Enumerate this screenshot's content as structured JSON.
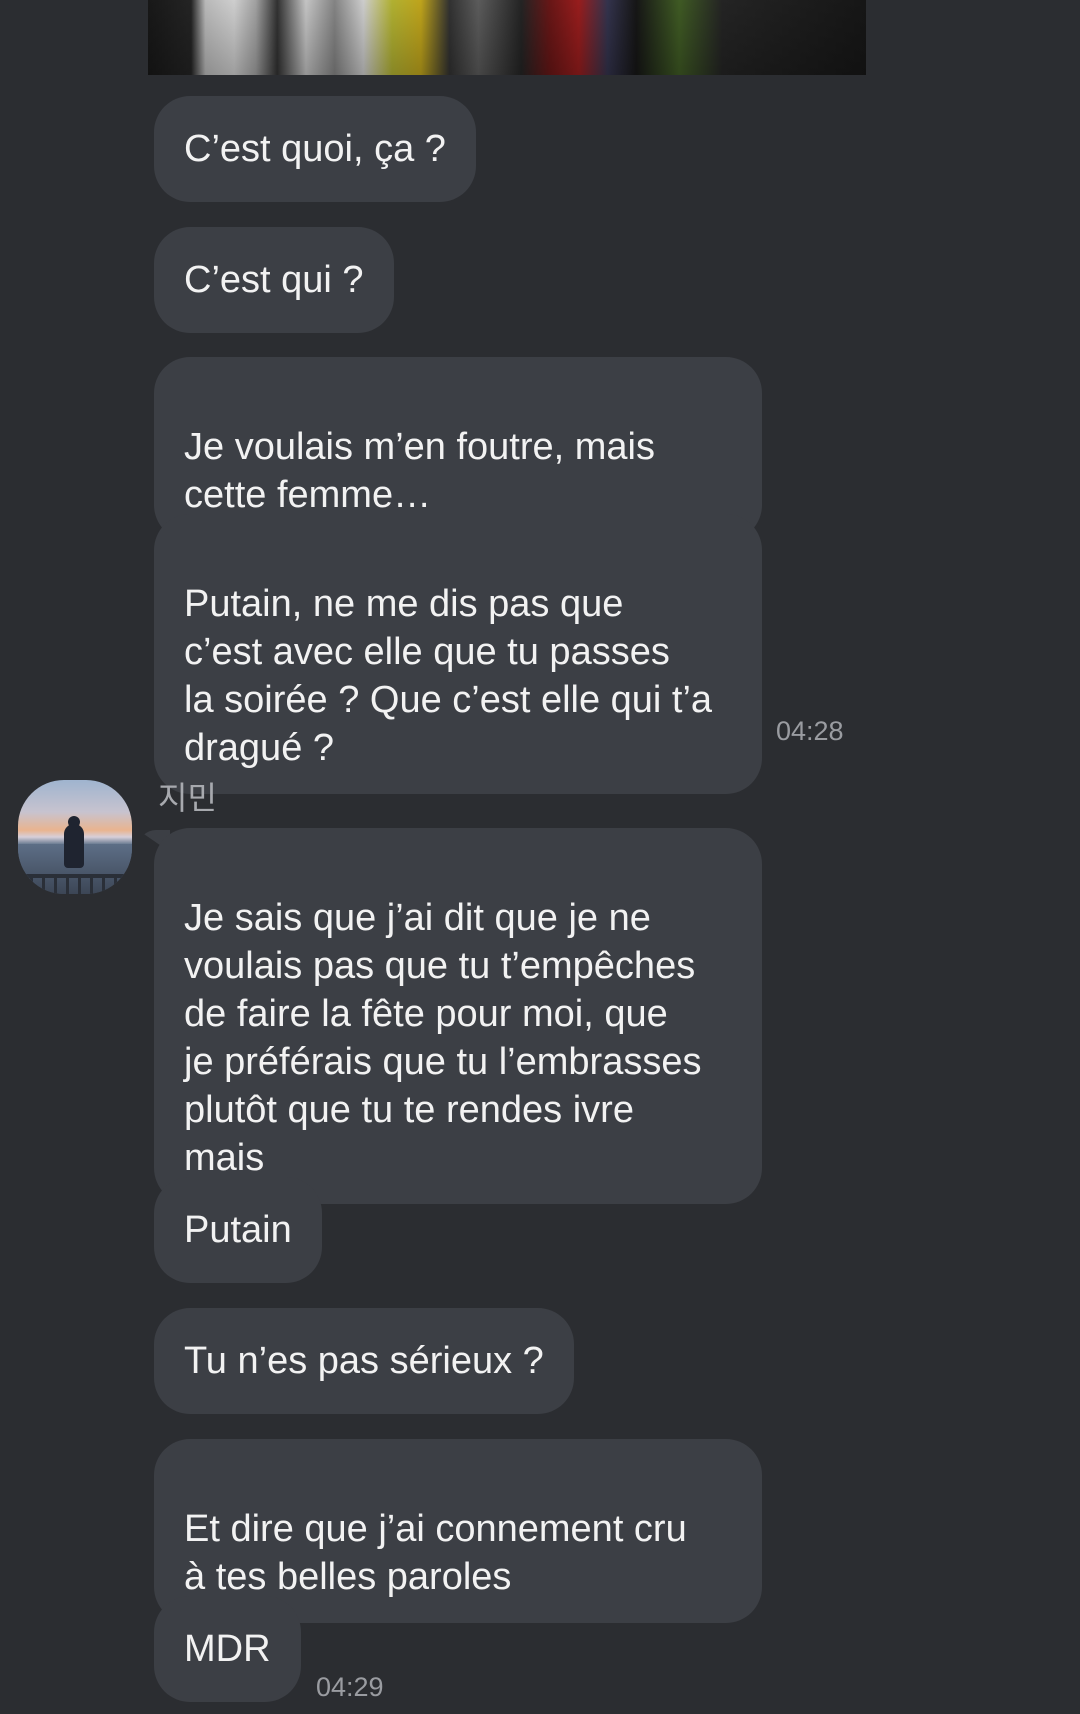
{
  "chat": {
    "sender_name": "지민",
    "messages_group_1": [
      "C’est quoi, ça ?",
      "C’est qui ?",
      "Je voulais m’en foutre, mais\ncette femme…",
      "Putain, ne me dis pas que\nc’est avec elle que tu passes\nla soirée ? Que c’est elle qui t’a\ndragué ?"
    ],
    "time_group_1": "04:28",
    "messages_group_2": [
      "Je sais que j’ai dit que je ne\nvoulais pas que tu t’empêches\nde faire la fête pour moi, que\nje préférais que tu l’embrasses\nplutôt que tu te rendes ivre\nmais",
      "Putain",
      "Tu n’es pas sérieux ?",
      "Et dire que j’ai connement cru\nà tes belles paroles",
      "MDR"
    ],
    "time_group_2": "04:29"
  }
}
